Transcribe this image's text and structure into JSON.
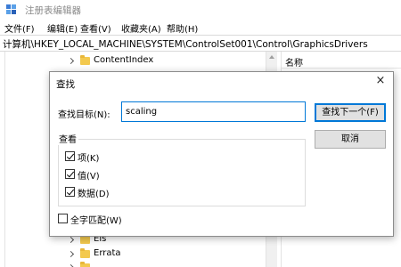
{
  "window": {
    "title": "注册表编辑器"
  },
  "menu": [
    "文件(F)",
    "编辑(E)",
    "查看(V)",
    "收藏夹(A)",
    "帮助(H)"
  ],
  "address": "计算机\\HKEY_LOCAL_MACHINE\\SYSTEM\\ControlSet001\\Control\\GraphicsDrivers",
  "list_header": {
    "name": "名称"
  },
  "tree": {
    "items": [
      {
        "label": "ContentIndex"
      },
      {
        "label": "Els"
      },
      {
        "label": "Errata"
      }
    ]
  },
  "dialog": {
    "title": "查找",
    "close": "×",
    "find_label": "查找目标(N):",
    "find_value": "scaling",
    "find_next": "查找下一个(F)",
    "cancel": "取消",
    "look_at": "查看",
    "options": [
      {
        "label": "项(K)",
        "checked": true
      },
      {
        "label": "值(V)",
        "checked": true
      },
      {
        "label": "数据(D)",
        "checked": true
      }
    ],
    "whole_word": {
      "label": "全字匹配(W)",
      "checked": false
    }
  },
  "colors": {
    "accent": "#0078d7",
    "folder": "#f3c94e"
  },
  "icons": {
    "app": "registry-editor-icon",
    "close": "close-icon",
    "folder": "folder-icon",
    "expand": "chevron-right-icon"
  }
}
